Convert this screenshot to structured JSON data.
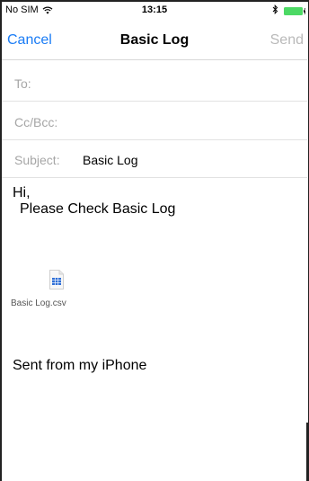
{
  "status_bar": {
    "carrier": "No SIM",
    "time": "13:15",
    "wifi_icon": "wifi-icon",
    "bluetooth_icon": "bluetooth-icon",
    "battery_icon": "battery-icon",
    "battery_color": "#4cd964"
  },
  "nav": {
    "cancel_label": "Cancel",
    "title": "Basic Log",
    "send_label": "Send",
    "accent_color": "#1a7cf5",
    "send_disabled_color": "#b9b9b9"
  },
  "fields": {
    "to_label": "To:",
    "to_value": "",
    "cc_label": "Cc/Bcc:",
    "cc_value": "",
    "subject_label": "Subject:",
    "subject_value": "Basic Log"
  },
  "body": {
    "line1": "Hi,",
    "line2": "Please Check Basic Log",
    "signature": "Sent from my iPhone"
  },
  "attachment": {
    "icon": "spreadsheet-file-icon",
    "name": "Basic Log.csv"
  }
}
